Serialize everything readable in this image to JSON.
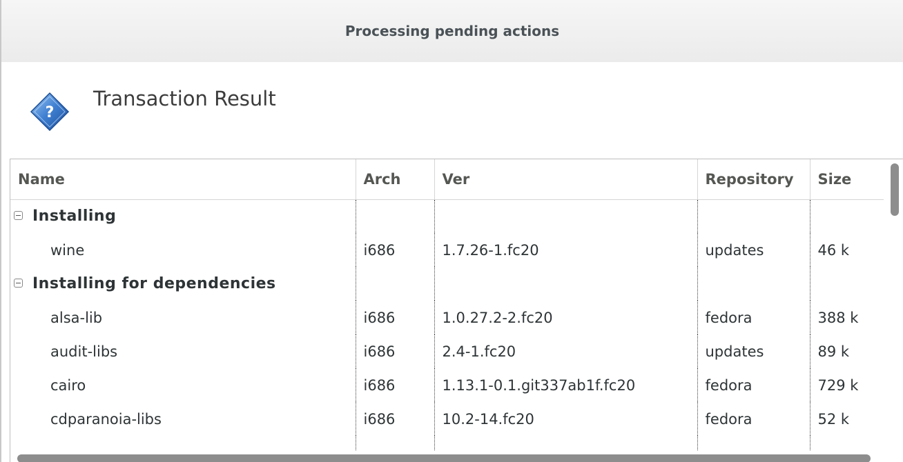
{
  "window": {
    "title": "Processing pending actions"
  },
  "header": {
    "icon": "question-diamond-icon",
    "heading": "Transaction Result"
  },
  "table": {
    "columns": [
      "Name",
      "Arch",
      "Ver",
      "Repository",
      "Size"
    ],
    "groups": [
      {
        "label": "Installing",
        "rows": [
          {
            "name": "wine",
            "arch": "i686",
            "ver": "1.7.26-1.fc20",
            "repo": "updates",
            "size": "46 k"
          }
        ]
      },
      {
        "label": "Installing for dependencies",
        "rows": [
          {
            "name": "alsa-lib",
            "arch": "i686",
            "ver": "1.0.27.2-2.fc20",
            "repo": "fedora",
            "size": "388 k"
          },
          {
            "name": "audit-libs",
            "arch": "i686",
            "ver": "2.4-1.fc20",
            "repo": "updates",
            "size": "89 k"
          },
          {
            "name": "cairo",
            "arch": "i686",
            "ver": "1.13.1-0.1.git337ab1f.fc20",
            "repo": "fedora",
            "size": "729 k"
          },
          {
            "name": "cdparanoia-libs",
            "arch": "i686",
            "ver": "10.2-14.fc20",
            "repo": "fedora",
            "size": "52 k"
          }
        ]
      }
    ]
  },
  "colors": {
    "icon_blue": "#3f7fd1",
    "scroll_thumb": "#8d8d8d"
  }
}
